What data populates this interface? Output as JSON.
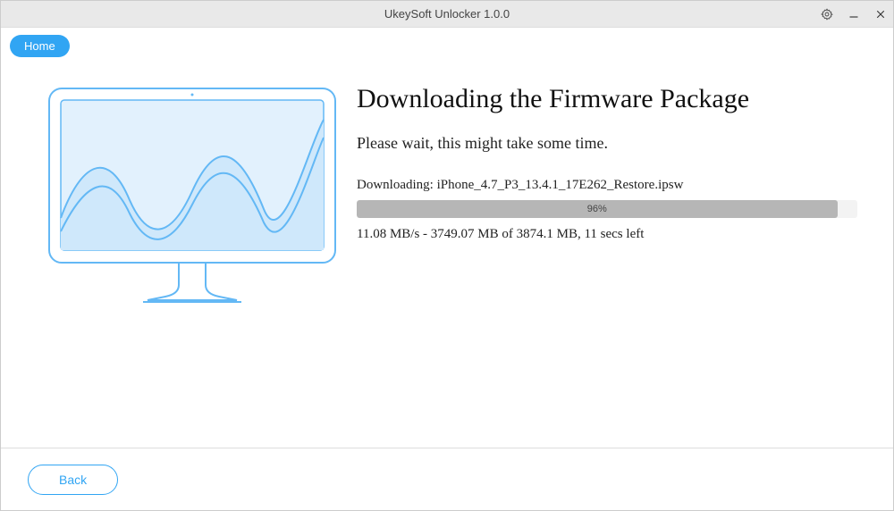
{
  "titlebar": {
    "title": "UkeySoft Unlocker 1.0.0"
  },
  "nav": {
    "home_label": "Home"
  },
  "main": {
    "heading": "Downloading the Firmware Package",
    "subtext": "Please wait, this might take some time.",
    "download_label": "Downloading: iPhone_4.7_P3_13.4.1_17E262_Restore.ipsw",
    "progress_percent": "96%",
    "progress_value": 96,
    "stats": "11.08 MB/s - 3749.07 MB of 3874.1 MB, 11 secs left"
  },
  "footer": {
    "back_label": "Back"
  },
  "colors": {
    "accent": "#31a5f3",
    "illustration_stroke": "#63b8f5",
    "illustration_fill": "#e2f1fd"
  }
}
